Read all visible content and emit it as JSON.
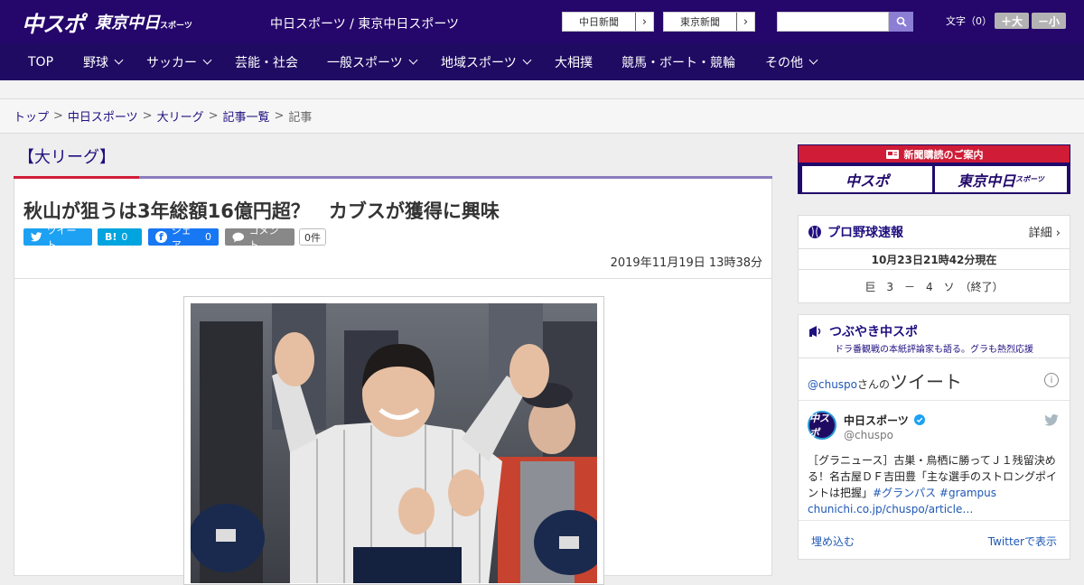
{
  "header": {
    "logo_text_1": "中スポ",
    "logo_text_2": "東京中日",
    "logo_text_2_small": "スポーツ",
    "site_title": "中日スポーツ / 東京中日スポーツ",
    "link_1": "中日新聞",
    "link_2": "東京新聞",
    "arrow": "›",
    "search_placeholder": "",
    "font_size_label": "文字（0）",
    "font_up": "＋大",
    "font_down": "－小"
  },
  "nav": {
    "items": [
      {
        "label": "TOP"
      },
      {
        "label": "野球"
      },
      {
        "label": "サッカー"
      },
      {
        "label": "芸能・社会"
      },
      {
        "label": "一般スポーツ"
      },
      {
        "label": "地域スポーツ"
      },
      {
        "label": "大相撲"
      },
      {
        "label": "競馬・ボート・競輪"
      },
      {
        "label": "その他"
      }
    ]
  },
  "breadcrumb": {
    "items": [
      "トップ",
      "中日スポーツ",
      "大リーグ",
      "記事一覧"
    ],
    "current": "記事",
    "sep": ">"
  },
  "article": {
    "category": "【大リーグ】",
    "headline": "秋山が狙うは3年総額16億円超？　カブスが獲得に興味",
    "share_tweet": "ツイート",
    "share_hatena": "B!",
    "share_hatena_count": "0",
    "share_facebook": "シェア",
    "share_facebook_count": "0",
    "share_comment": "コメント",
    "comment_count": "0件",
    "date": "2019年11月19日 13時38分"
  },
  "sidebar": {
    "subscribe_title": "新聞購読のご案内",
    "subscribe_btn_1": "中スポ",
    "subscribe_btn_2": "東京中日",
    "subscribe_btn_2_small": "スポーツ",
    "score_title": "プロ野球速報",
    "score_detail": "詳細 ›",
    "score_time": "10月23日21時42分現在",
    "score_line": "巨　3　－　4　ソ　（終了）",
    "tweet_section_title": "つぶやき中スポ",
    "tweet_section_sub": "ドラ番観戦の本紙評論家も語る。グラも熱烈応援",
    "tweet_head_user": "@chuspo",
    "tweet_head_suffix": "さんの",
    "tweet_head_big": "ツイート",
    "tweet_info": "i",
    "tweet_name": "中日スポーツ",
    "tweet_handle": "@chuspo",
    "tweet_avatar_text": "中スポ",
    "tweet_text": "［グラニュース］古巣・鳥栖に勝ってＪ１残留決める！名古屋ＤＦ吉田豊「主な選手のストロングポイントは把握」",
    "tweet_tag_1": "#グランパス",
    "tweet_tag_2": "#grampus",
    "tweet_link": "chunichi.co.jp/chuspo/article…",
    "tweet_embed": "埋め込む",
    "tweet_view": "Twitterで表示"
  },
  "colors": {
    "header_bg": "#25066b",
    "nav_bg": "#1f0b62",
    "accent_red": "#d01c36",
    "link": "#1f0f80",
    "twitter_blue": "#1da1f2",
    "hatena_blue": "#00a4de",
    "facebook_blue": "#1877f2",
    "comment_gray": "#888888"
  }
}
